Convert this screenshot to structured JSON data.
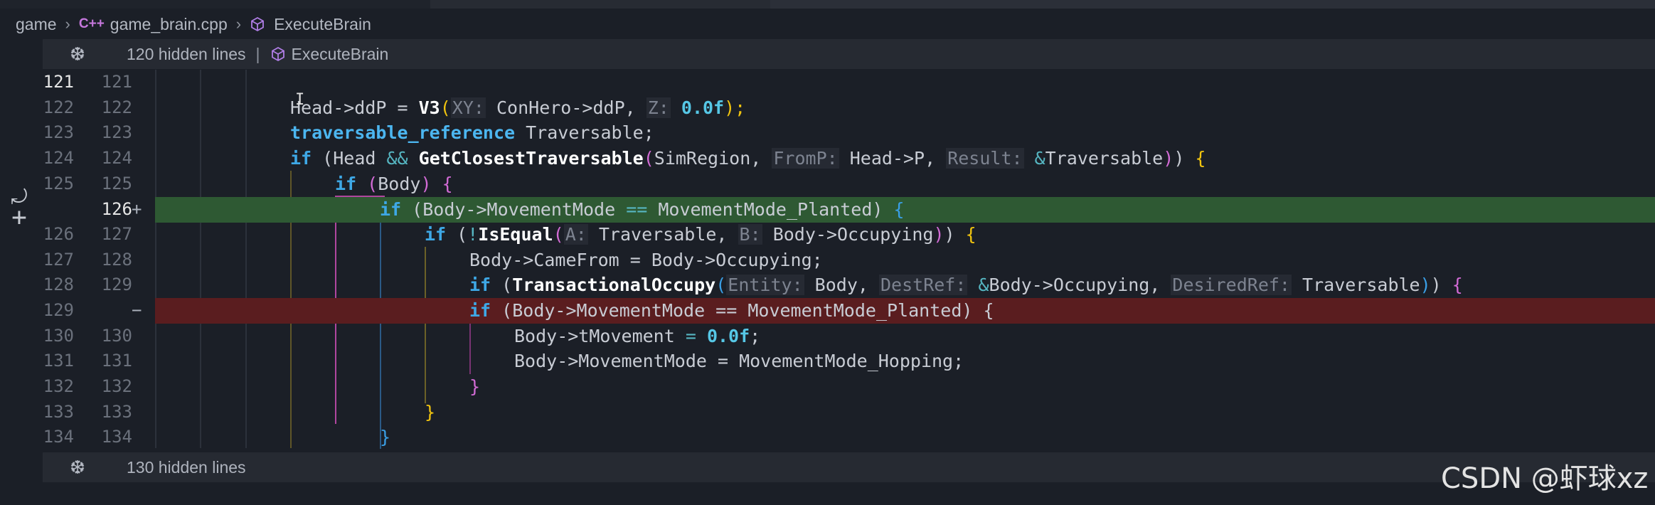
{
  "breadcrumb": {
    "items": [
      "game",
      "game_brain.cpp",
      "ExecuteBrain"
    ],
    "file_badge": "C++"
  },
  "hidden_top": {
    "text": "120 hidden lines",
    "symbol": "ExecuteBrain"
  },
  "hidden_bottom": {
    "text": "130 hidden lines"
  },
  "watermark": "CSDN @虾球xz",
  "line_numbers": {
    "old": [
      "121",
      "122",
      "123",
      "124",
      "125",
      "",
      "126",
      "127",
      "128",
      "129",
      "130",
      "131",
      "132",
      "133",
      "134"
    ],
    "new": [
      "121",
      "122",
      "123",
      "124",
      "125",
      "126",
      "127",
      "128",
      "129",
      "",
      "130",
      "131",
      "132",
      "133",
      "134"
    ]
  },
  "markers": {
    "added": "+",
    "removed": "−"
  },
  "code": {
    "l1": {
      "a": "Head->ddP = ",
      "b": "V3",
      "c": "(",
      "h1": "XY:",
      "d": " ConHero->ddP, ",
      "h2": "Z:",
      "e": " ",
      "n": "0.0f",
      "f": ");"
    },
    "l2": {
      "t": "traversable_reference",
      "r": " Traversable;"
    },
    "l3": {
      "kw": "if",
      "a": " (Head ",
      "op": "&&",
      "sp": " ",
      "fn": "GetClosestTraversable",
      "c": "(",
      "d": "SimRegion, ",
      "h1": "FromP:",
      "e": " Head->P, ",
      "h2": "Result:",
      "f": " ",
      "amp": "&",
      "g": "Traversable",
      "h": ")",
      "i": ") ",
      "j": "{"
    },
    "l4": {
      "kw": "if",
      "a": " ",
      "p": "(",
      "b": "Body",
      "c": ")",
      "d": " ",
      "e": "{"
    },
    "l5": {
      "kw": "if",
      "a": " (Body->MovementMode ",
      "op": "==",
      "b": " MovementMode_Planted) ",
      "c": "{"
    },
    "l6": {
      "kw": "if",
      "a": " (",
      "bang": "!",
      "fn": "IsEqual",
      "c": "(",
      "h1": "A:",
      "d": " Traversable, ",
      "h2": "B:",
      "e": " Body->Occupying",
      "f": ")",
      "g": ") ",
      "h": "{"
    },
    "l7": {
      "a": "Body->CameFrom = Body->Occupying;"
    },
    "l8": {
      "kw": "if",
      "a": " (",
      "fn": "TransactionalOccupy",
      "c": "(",
      "h1": "Entity:",
      "d": " Body, ",
      "h2": "DestRef:",
      "e": " ",
      "amp": "&",
      "f": "Body->Occupying, ",
      "h3": "DesiredRef:",
      "g": " Traversable",
      "h": ")",
      "i": ") ",
      "j": "{"
    },
    "l9": {
      "kw": "if",
      "a": " (Body->MovementMode == MovementMode_Planted) {"
    },
    "l10": {
      "a": "Body->tMovement ",
      "op": "=",
      "sp": " ",
      "n": "0.0f",
      "b": ";"
    },
    "l11": {
      "a": "Body->MovementMode = MovementMode_Hopping;"
    },
    "l12": {
      "a": "}"
    },
    "l13": {
      "a": "}"
    },
    "l14": {
      "a": "}"
    }
  }
}
